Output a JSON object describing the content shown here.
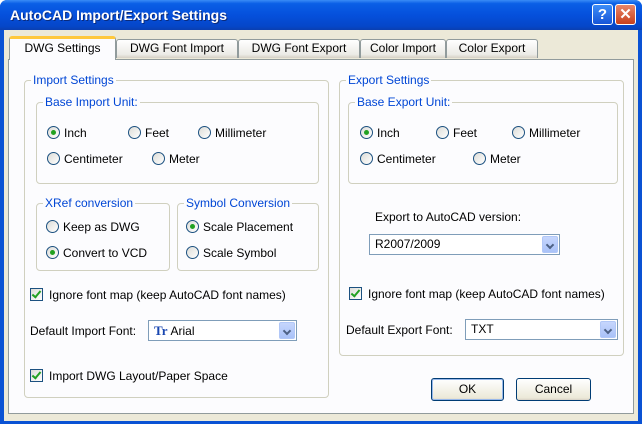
{
  "window": {
    "title": "AutoCAD Import/Export Settings",
    "help_glyph": "?",
    "close_glyph": "✕"
  },
  "tabs": [
    "DWG Settings",
    "DWG Font Import",
    "DWG Font Export",
    "Color Import",
    "Color Export"
  ],
  "import": {
    "group_label": "Import Settings",
    "unit_label": "Base Import Unit:",
    "units": {
      "inch": "Inch",
      "feet": "Feet",
      "millimeter": "Millimeter",
      "centimeter": "Centimeter",
      "meter": "Meter"
    },
    "selected_unit": "Inch",
    "xref_label": "XRef conversion",
    "xref_keep": "Keep as DWG",
    "xref_convert": "Convert to VCD",
    "xref_selected": "Convert to VCD",
    "symbol_label": "Symbol Conversion",
    "symbol_placement": "Scale Placement",
    "symbol_symbol": "Scale Symbol",
    "symbol_selected": "Scale Placement",
    "ignore_font_map": "Ignore font map (keep AutoCAD font names)",
    "ignore_font_map_checked": true,
    "default_font_label": "Default Import Font:",
    "default_font_value": "Arial",
    "font_icon": "TrueType-font-icon",
    "layout_label": "Import DWG Layout/Paper Space",
    "layout_checked": true
  },
  "export": {
    "group_label": "Export Settings",
    "unit_label": "Base Export Unit:",
    "units": {
      "inch": "Inch",
      "feet": "Feet",
      "millimeter": "Millimeter",
      "centimeter": "Centimeter",
      "meter": "Meter"
    },
    "selected_unit": "Inch",
    "version_label": "Export to AutoCAD version:",
    "version_value": "R2007/2009",
    "ignore_font_map": "Ignore font map (keep AutoCAD font names)",
    "ignore_font_map_checked": true,
    "default_font_label": "Default Export Font:",
    "default_font_value": "TXT"
  },
  "buttons": {
    "ok": "OK",
    "cancel": "Cancel"
  },
  "colors": {
    "title_bar": "#0550dc",
    "group_label": "#0046d5",
    "active_tab_accent": "#ffc83c",
    "close_button": "#c8401c"
  }
}
